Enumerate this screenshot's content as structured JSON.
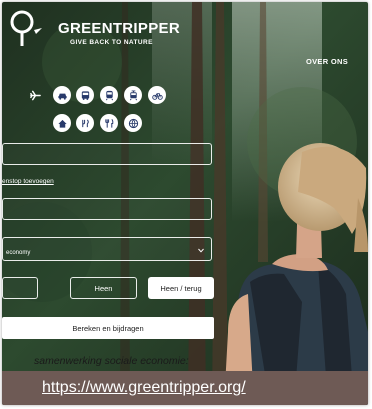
{
  "brand": {
    "name": "GREENTRIPPER",
    "tagline": "GIVE BACK TO NATURE"
  },
  "nav": {
    "about_label": "OVER ONS"
  },
  "transport_modes": [
    {
      "icon": "airplane-icon",
      "active": true
    },
    {
      "icon": "car-icon",
      "active": false
    },
    {
      "icon": "bus-icon",
      "active": false
    },
    {
      "icon": "train-icon",
      "active": false
    },
    {
      "icon": "tram-icon",
      "active": false
    },
    {
      "icon": "bicycle-icon",
      "active": false
    }
  ],
  "extra_modes": [
    {
      "icon": "home-icon"
    },
    {
      "icon": "food-icon"
    },
    {
      "icon": "restaurant-icon"
    },
    {
      "icon": "globe-icon"
    }
  ],
  "form": {
    "from_value": "",
    "stopover_link": "enstop toevoegen",
    "to_value": "",
    "class_value": "economy",
    "passengers_value": "",
    "one_way_label": "Heen",
    "return_label": "Heen / terug",
    "calculate_label": "Bereken en bijdragen"
  },
  "caption": {
    "text": "samenwerking sociale economie:",
    "url": "https://www.greentripper.org/"
  },
  "colors": {
    "accent_dark": "#283a6b",
    "footer_bar": "#6e5a55"
  }
}
